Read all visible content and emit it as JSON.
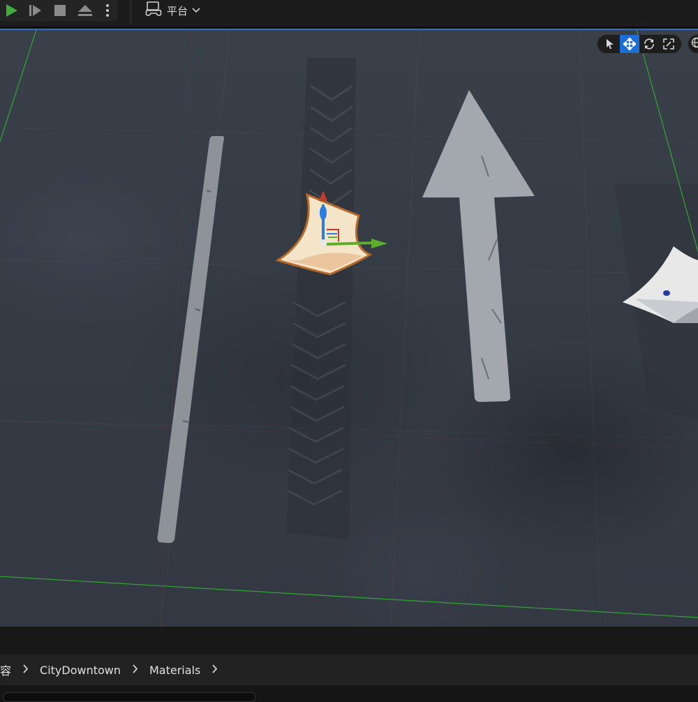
{
  "toolbar": {
    "play_icon": "play-icon",
    "step_icon": "step-forward-icon",
    "stop_icon": "stop-icon",
    "eject_icon": "eject-icon",
    "more_icon": "more-vertical-icon",
    "platform_label": "平台",
    "accent_color": "#3fae3f"
  },
  "viewport_tools": {
    "items": [
      "select-icon",
      "move-icon",
      "rotate-icon",
      "scale-icon"
    ],
    "active": "move-icon",
    "globe_icon": "globe-icon",
    "active_color": "#1c6fd6"
  },
  "breadcrumb": {
    "items": [
      "容",
      "CityDowntown",
      "Materials"
    ]
  }
}
